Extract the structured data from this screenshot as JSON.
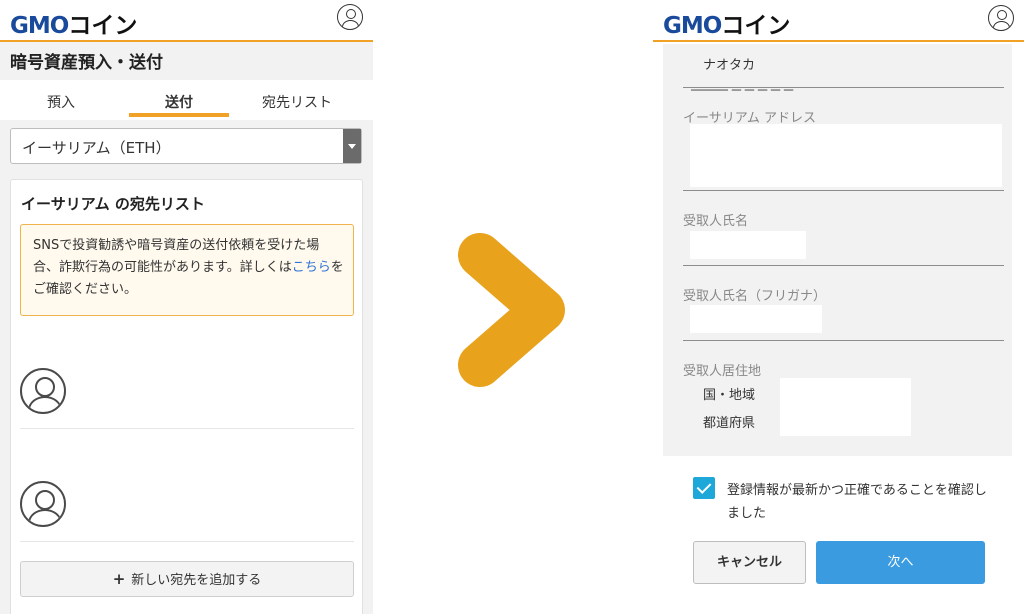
{
  "left": {
    "header": {
      "logo_main": "GMO",
      "logo_tail": "コイン",
      "user_icon": "user-circle-icon"
    },
    "page_title": "暗号資産預入・送付",
    "tabs": [
      {
        "label": "預入",
        "active": false
      },
      {
        "label": "送付",
        "active": true
      },
      {
        "label": "宛先リスト",
        "active": false
      }
    ],
    "currency_select": {
      "value": "イーサリアム（ETH）"
    },
    "list_card": {
      "title": "イーサリアム の宛先リスト",
      "warning": {
        "text_before": "SNSで投資勧誘や暗号資産の送付依頼を受けた場合、詐欺行為の可能性があります。詳しくは",
        "link": "こちら",
        "text_after": "をご確認ください。"
      },
      "add_button": "新しい宛先を追加する"
    }
  },
  "arrow_color": "#e8a21b",
  "right": {
    "header": {
      "logo_main": "GMO",
      "logo_tail": "コイン",
      "user_icon": "user-circle-icon"
    },
    "form": {
      "recipient_value": "ナオタカ",
      "eth_address_label": "イーサリアム アドレス",
      "recipient_name_label": "受取人氏名",
      "recipient_kana_label": "受取人氏名（フリガナ）",
      "address_label": "受取人居住地",
      "country_label": "国・地域",
      "prefecture_label": "都道府県"
    },
    "confirm_text": "登録情報が最新かつ正確であることを確認しました",
    "confirm_checked": true,
    "cancel_button": "キャンセル",
    "next_button": "次へ"
  }
}
